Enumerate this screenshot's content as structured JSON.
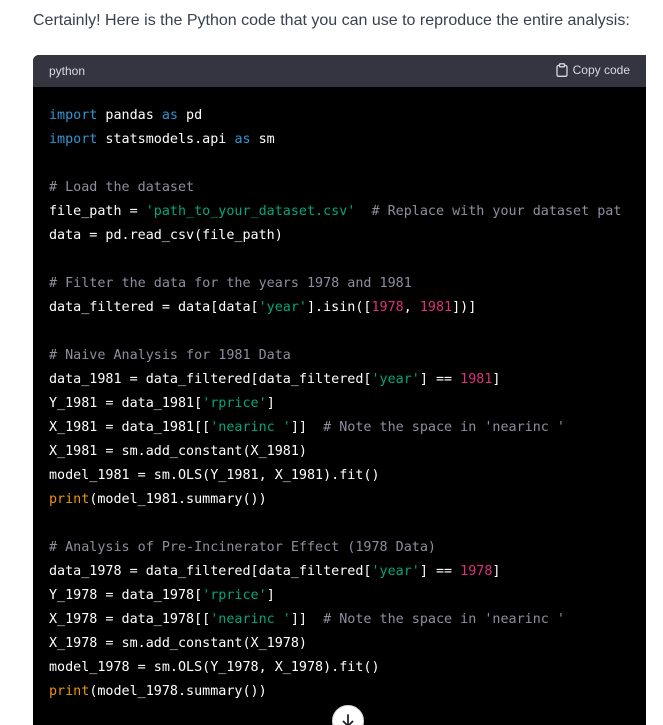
{
  "message": {
    "intro": "Certainly! Here is the Python code that you can use to reproduce the entire analysis:"
  },
  "code_block": {
    "language": "python",
    "copy_label": "Copy code",
    "copy_icon": "clipboard-icon",
    "lines": [
      [
        {
          "t": "import",
          "c": "kw"
        },
        {
          "t": " pandas "
        },
        {
          "t": "as",
          "c": "kw"
        },
        {
          "t": " pd"
        }
      ],
      [
        {
          "t": "import",
          "c": "kw"
        },
        {
          "t": " statsmodels.api "
        },
        {
          "t": "as",
          "c": "kw"
        },
        {
          "t": " sm"
        }
      ],
      [],
      [
        {
          "t": "# Load the dataset",
          "c": "cm"
        }
      ],
      [
        {
          "t": "file_path = "
        },
        {
          "t": "'path_to_your_dataset.csv'",
          "c": "str"
        },
        {
          "t": "  "
        },
        {
          "t": "# Replace with your dataset pat",
          "c": "cm"
        }
      ],
      [
        {
          "t": "data = pd.read_csv(file_path)"
        }
      ],
      [],
      [
        {
          "t": "# Filter the data for the years 1978 and 1981",
          "c": "cm"
        }
      ],
      [
        {
          "t": "data_filtered = data[data["
        },
        {
          "t": "'year'",
          "c": "str"
        },
        {
          "t": "].isin(["
        },
        {
          "t": "1978",
          "c": "num"
        },
        {
          "t": ", "
        },
        {
          "t": "1981",
          "c": "num"
        },
        {
          "t": "])]"
        }
      ],
      [],
      [
        {
          "t": "# Naive Analysis for 1981 Data",
          "c": "cm"
        }
      ],
      [
        {
          "t": "data_1981 = data_filtered[data_filtered["
        },
        {
          "t": "'year'",
          "c": "str"
        },
        {
          "t": "] == "
        },
        {
          "t": "1981",
          "c": "num"
        },
        {
          "t": "]"
        }
      ],
      [
        {
          "t": "Y_1981 = data_1981["
        },
        {
          "t": "'rprice'",
          "c": "str"
        },
        {
          "t": "]"
        }
      ],
      [
        {
          "t": "X_1981 = data_1981[["
        },
        {
          "t": "'nearinc '",
          "c": "str"
        },
        {
          "t": "]]  "
        },
        {
          "t": "# Note the space in 'nearinc '",
          "c": "cm"
        }
      ],
      [
        {
          "t": "X_1981 = sm.add_constant(X_1981)"
        }
      ],
      [
        {
          "t": "model_1981 = sm.OLS(Y_1981, X_1981).fit()"
        }
      ],
      [
        {
          "t": "print",
          "c": "fn"
        },
        {
          "t": "(model_1981.summary())"
        }
      ],
      [],
      [
        {
          "t": "# Analysis of Pre-Incinerator Effect (1978 Data)",
          "c": "cm"
        }
      ],
      [
        {
          "t": "data_1978 = data_filtered[data_filtered["
        },
        {
          "t": "'year'",
          "c": "str"
        },
        {
          "t": "] == "
        },
        {
          "t": "1978",
          "c": "num"
        },
        {
          "t": "]"
        }
      ],
      [
        {
          "t": "Y_1978 = data_1978["
        },
        {
          "t": "'rprice'",
          "c": "str"
        },
        {
          "t": "]"
        }
      ],
      [
        {
          "t": "X_1978 = data_1978[["
        },
        {
          "t": "'nearinc '",
          "c": "str"
        },
        {
          "t": "]]  "
        },
        {
          "t": "# Note the space in 'nearinc '",
          "c": "cm"
        }
      ],
      [
        {
          "t": "X_1978 = sm.add_constant(X_1978)"
        }
      ],
      [
        {
          "t": "model_1978 = sm.OLS(Y_1978, X_1978).fit()"
        }
      ],
      [
        {
          "t": "print",
          "c": "fn"
        },
        {
          "t": "(model_1978.summary())"
        }
      ]
    ]
  },
  "scroll_button": {
    "icon": "arrow-down-icon"
  },
  "colors": {
    "code_background": "#000000",
    "header_background": "#343541",
    "keyword": "#2e95d3",
    "string": "#00a67d",
    "number": "#df3079",
    "comment": "#8e8ea0",
    "builtin": "#e9950c"
  }
}
